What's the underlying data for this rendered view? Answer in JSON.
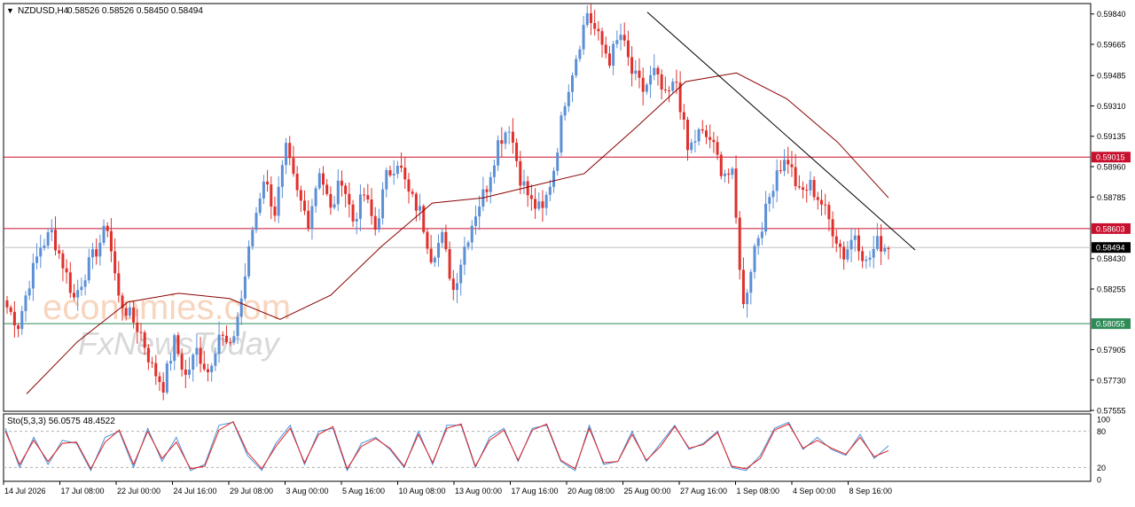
{
  "header": {
    "symbol": "NZDUSD,H4",
    "ohlc": "0.58526 0.58526 0.58450 0.58494"
  },
  "watermark": {
    "line1": "economies.com",
    "line2": "FxNewsToday"
  },
  "colors": {
    "bull": "#5b8fd6",
    "bear": "#e0302b",
    "sma": "#8b0000",
    "resistance_line": "#c8102e",
    "support_line": "#2e8b57",
    "stoch_main": "#4a90d9",
    "stoch_signal": "#e02020"
  },
  "chart_data": [
    {
      "type": "candlestick",
      "title": "NZDUSD,H4",
      "ylim": [
        0.5755,
        0.599
      ],
      "price_ticks": [
        "0.59840",
        "0.59665",
        "0.59485",
        "0.59310",
        "0.59135",
        "0.58960",
        "0.58785",
        "0.58430",
        "0.58255",
        "0.57905",
        "0.57730",
        "0.57555"
      ],
      "x_tick_labels": [
        "14 Jul 2026",
        "17 Jul 08:00",
        "22 Jul 00:00",
        "24 Jul 16:00",
        "29 Jul 08:00",
        "3 Aug 00:00",
        "5 Aug 16:00",
        "10 Aug 08:00",
        "13 Aug 00:00",
        "17 Aug 16:00",
        "20 Aug 08:00",
        "25 Aug 00:00",
        "27 Aug 16:00",
        "1 Sep 08:00",
        "4 Sep 00:00",
        "8 Sep 16:00"
      ],
      "horizontal_levels": [
        {
          "label": "0.59015",
          "value": 0.59015,
          "kind": "resistance"
        },
        {
          "label": "0.58603",
          "value": 0.58603,
          "kind": "resistance"
        },
        {
          "label": "0.58494",
          "value": 0.58494,
          "kind": "current"
        },
        {
          "label": "0.58055",
          "value": 0.58055,
          "kind": "support"
        }
      ],
      "path_points": [
        0.5815,
        0.5805,
        0.583,
        0.585,
        0.5858,
        0.584,
        0.582,
        0.5835,
        0.5848,
        0.5862,
        0.582,
        0.581,
        0.58,
        0.578,
        0.577,
        0.5795,
        0.5775,
        0.579,
        0.5778,
        0.58,
        0.579,
        0.582,
        0.586,
        0.589,
        0.587,
        0.5905,
        0.588,
        0.5865,
        0.5895,
        0.587,
        0.589,
        0.5865,
        0.588,
        0.586,
        0.589,
        0.59,
        0.588,
        0.587,
        0.5845,
        0.5855,
        0.5825,
        0.585,
        0.587,
        0.5885,
        0.591,
        0.592,
        0.589,
        0.5875,
        0.587,
        0.5895,
        0.5935,
        0.596,
        0.5985,
        0.597,
        0.5958,
        0.5972,
        0.595,
        0.594,
        0.595,
        0.5935,
        0.5945,
        0.5905,
        0.5915,
        0.5912,
        0.5895,
        0.589,
        0.5815,
        0.585,
        0.587,
        0.5895,
        0.59,
        0.588,
        0.5885,
        0.5875,
        0.586,
        0.5845,
        0.5858,
        0.584,
        0.5852,
        0.5849
      ],
      "trendline_start": [
        0.5985
      ],
      "trendline_end": [
        0.5848
      ],
      "sma_path": [
        0.5765,
        0.5795,
        0.5818,
        0.5823,
        0.582,
        0.5808,
        0.5822,
        0.585,
        0.5875,
        0.5878,
        0.5885,
        0.5892,
        0.5918,
        0.5945,
        0.595,
        0.5935,
        0.591,
        0.5878
      ]
    },
    {
      "type": "line",
      "title": "Sto(5,3,3) 56.0575 48.4522",
      "ylim": [
        0,
        100
      ],
      "level_ticks": [
        "100",
        "80",
        "20",
        "0"
      ],
      "series": [
        {
          "name": "main",
          "values": [
            85,
            20,
            70,
            25,
            65,
            60,
            15,
            70,
            80,
            20,
            85,
            30,
            70,
            15,
            25,
            90,
            95,
            40,
            15,
            60,
            90,
            25,
            80,
            85,
            15,
            60,
            70,
            50,
            20,
            80,
            25,
            90,
            90,
            20,
            70,
            85,
            30,
            85,
            90,
            30,
            15,
            90,
            25,
            30,
            80,
            30,
            60,
            90,
            50,
            60,
            80,
            20,
            15,
            40,
            85,
            95,
            50,
            70,
            50,
            40,
            75,
            35,
            56
          ]
        },
        {
          "name": "signal",
          "values": [
            80,
            25,
            65,
            30,
            60,
            62,
            18,
            62,
            82,
            25,
            80,
            35,
            62,
            18,
            22,
            82,
            96,
            45,
            18,
            55,
            85,
            28,
            75,
            88,
            18,
            55,
            68,
            52,
            22,
            75,
            28,
            85,
            92,
            22,
            65,
            82,
            32,
            82,
            92,
            32,
            18,
            85,
            28,
            30,
            75,
            32,
            55,
            88,
            52,
            58,
            78,
            22,
            18,
            35,
            82,
            92,
            52,
            65,
            52,
            42,
            70,
            38,
            48
          ]
        }
      ]
    }
  ]
}
